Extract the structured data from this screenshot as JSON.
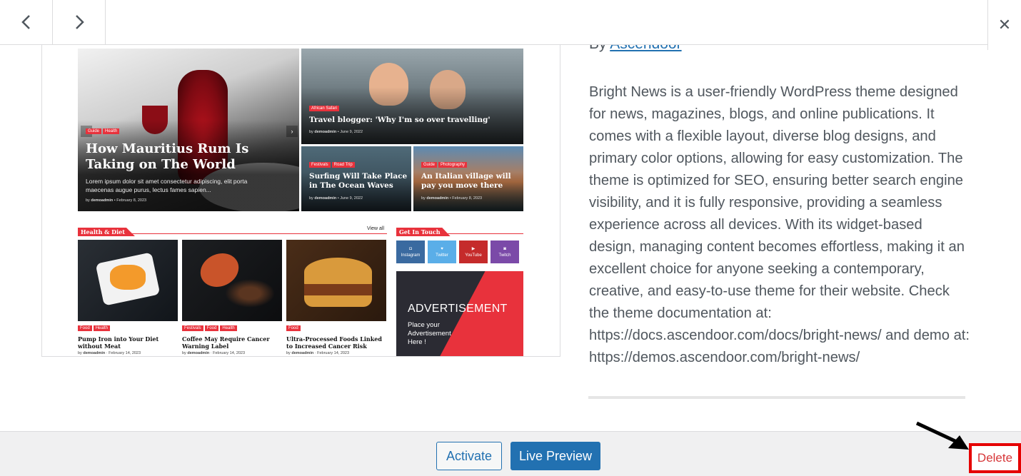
{
  "nav": {
    "prev_icon": "chevron-left-icon",
    "next_icon": "chevron-right-icon",
    "close_icon": "close-icon",
    "close_glyph": "✕"
  },
  "preview": {
    "hero": {
      "tags": [
        "Guide",
        "Health"
      ],
      "title": "How Mauritius Rum Is Taking on The World",
      "excerpt": "Lorem ipsum dolor sit amet consectetur adipiscing, elit porta maecenas augue purus, lectus fames sapien...",
      "meta_by": "by",
      "meta_author": "demoadmin",
      "meta_date": "February 8, 2023"
    },
    "card_top": {
      "tag": "African Safari",
      "title": "Travel blogger: 'Why I'm so over travelling'",
      "meta_by": "by",
      "meta_author": "demoadmin",
      "meta_date": "June 9, 2022"
    },
    "card_left": {
      "tags": [
        "Festivals",
        "Road Trip"
      ],
      "title": "Surfing Will Take Place in The Ocean Waves",
      "meta_by": "by",
      "meta_author": "demoadmin",
      "meta_date": "June 9, 2022"
    },
    "card_right": {
      "tags": [
        "Guide",
        "Photography"
      ],
      "title": "An Italian village will pay you move there",
      "meta_by": "by",
      "meta_author": "demoadmin",
      "meta_date": "February 8, 2023"
    },
    "section_health": "Health & Diet",
    "view_all": "View all",
    "section_touch": "Get In Touch",
    "posts": [
      {
        "tags": [
          "Food",
          "Health"
        ],
        "title": "Pump Iron into Your Diet without Meat",
        "by": "by",
        "author": "demoadmin",
        "date": "February 14, 2023"
      },
      {
        "tags": [
          "Festivals",
          "Food",
          "Health"
        ],
        "title": "Coffee May Require Cancer Warning Label",
        "by": "by",
        "author": "demoadmin",
        "date": "February 14, 2023"
      },
      {
        "tags": [
          "Food"
        ],
        "title": "Ultra-Processed Foods Linked to Increased Cancer Risk",
        "by": "by",
        "author": "demoadmin",
        "date": "February 14, 2023"
      }
    ],
    "social": [
      {
        "label": "Instagram",
        "color": "#3a6aa0"
      },
      {
        "label": "Twitter",
        "color": "#5aaee8"
      },
      {
        "label": "YouTube",
        "color": "#c52b2b"
      },
      {
        "label": "Twitch",
        "color": "#7b4aa8"
      }
    ],
    "ad": {
      "title": "ADVERTISEMENT",
      "line1": "Place your",
      "line2": "Advertisement",
      "line3": "Here !"
    }
  },
  "details": {
    "by_label": "By",
    "author": "Ascendoor",
    "description": "Bright News is a user-friendly WordPress theme designed for news, magazines, blogs, and online publications. It comes with a flexible layout, diverse blog designs, and primary color options, allowing for easy customization. The theme is optimized for SEO, ensuring better search engine visibility, and it is fully responsive, providing a seamless experience across all devices. With its widget-based design, managing content becomes effortless, making it an excellent choice for anyone seeking a contemporary, creative, and easy-to-use theme for their website. Check the theme documentation at: https://docs.ascendoor.com/docs/bright-news/ and demo at: https://demos.ascendoor.com/bright-news/"
  },
  "footer": {
    "activate_label": "Activate",
    "live_preview_label": "Live Preview",
    "delete_label": "Delete"
  },
  "colors": {
    "accent": "#2271b1",
    "delete_text": "#d63638",
    "highlight": "#e50000",
    "brand_red": "#e8323c"
  }
}
